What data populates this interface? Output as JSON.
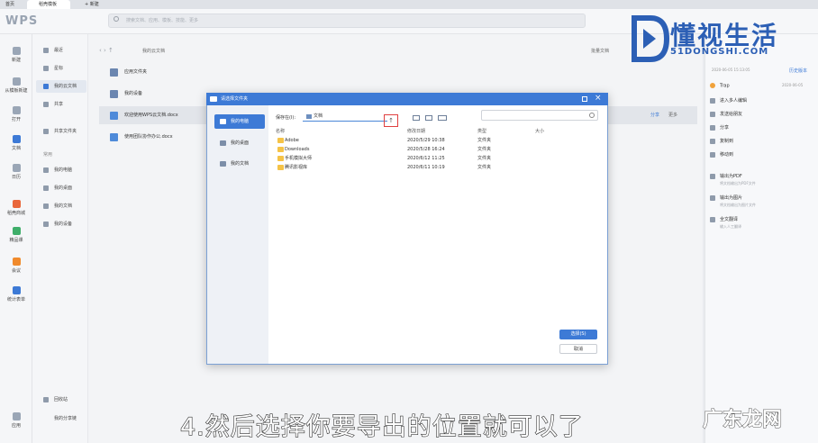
{
  "tabs": {
    "home": "首页",
    "template": "稻壳模板",
    "new": "新建"
  },
  "header": {
    "logo": "WPS",
    "search_placeholder": "搜索文档、应用、模板、技能、更多"
  },
  "leftnav": [
    {
      "label": "新建",
      "icon": "plus-icon"
    },
    {
      "label": "从模板新建",
      "icon": "template-icon"
    },
    {
      "label": "打开",
      "icon": "folder-icon"
    },
    {
      "label": "文档",
      "icon": "document-icon"
    },
    {
      "label": "日历",
      "icon": "calendar-icon"
    },
    {
      "label": "稻壳商城",
      "icon": "shop-icon"
    },
    {
      "label": "精品课",
      "icon": "course-icon"
    },
    {
      "label": "会议",
      "icon": "meeting-icon"
    },
    {
      "label": "统计表单",
      "icon": "form-icon"
    },
    {
      "label": "应用",
      "icon": "apps-icon"
    }
  ],
  "side2": {
    "items": [
      "最近",
      "星标",
      "我的云文档",
      "共享"
    ],
    "shared_folder": "共享文件夹",
    "section": "常用",
    "common": [
      "我的电脑",
      "我的桌面",
      "我的文档",
      "我的设备"
    ],
    "recycle": "回收站",
    "share_link": "我的分享链"
  },
  "main": {
    "breadcrumb": "我的云文档",
    "batch": "批量文档",
    "rows": [
      "应用文件夹",
      "我的设备",
      "欢迎使用WPS云文档.docx",
      "使用团队协作办公.docx"
    ],
    "row_actions": [
      "分享",
      "更多"
    ]
  },
  "rightpanel": {
    "date": "2020-06-05 15:13:05",
    "history": "历史版本",
    "user": "Trap",
    "user_date": "2020-06-05",
    "actions": [
      "进入多人编辑",
      "发送给朋友",
      "分享",
      "复制到",
      "移动到"
    ],
    "export_pdf": "输出为PDF",
    "export_pdf_desc": "将文档输出为PDF文件",
    "export_img": "输出为图片",
    "export_img_desc": "将文档输出为图片文件",
    "translate": "全文翻译",
    "translate_desc": "输入人工翻译"
  },
  "dialog": {
    "title": "请选择文件夹",
    "nav": [
      "我的电脑",
      "我的桌面",
      "我的文档"
    ],
    "location_label": "保存在(I):",
    "location_value": "文档",
    "columns": {
      "name": "名称",
      "date": "修改日期",
      "type": "类型",
      "size": "大小"
    },
    "files": [
      {
        "name": "Adobe",
        "date": "2020/5/29 10:38",
        "type": "文件夹"
      },
      {
        "name": "Downloads",
        "date": "2020/5/28 16:24",
        "type": "文件夹"
      },
      {
        "name": "手机模拟大师",
        "date": "2020/6/12 11:25",
        "type": "文件夹"
      },
      {
        "name": "腾讯影视库",
        "date": "2020/6/11 10:19",
        "type": "文件夹"
      }
    ],
    "select_button": "选择(S)",
    "cancel_button": "取消"
  },
  "caption": "4.然后选择你要导出的位置就可以了",
  "watermark": {
    "brand": "懂视生活",
    "domain": "51DONGSHI.COM",
    "bottom": "广东龙网"
  }
}
